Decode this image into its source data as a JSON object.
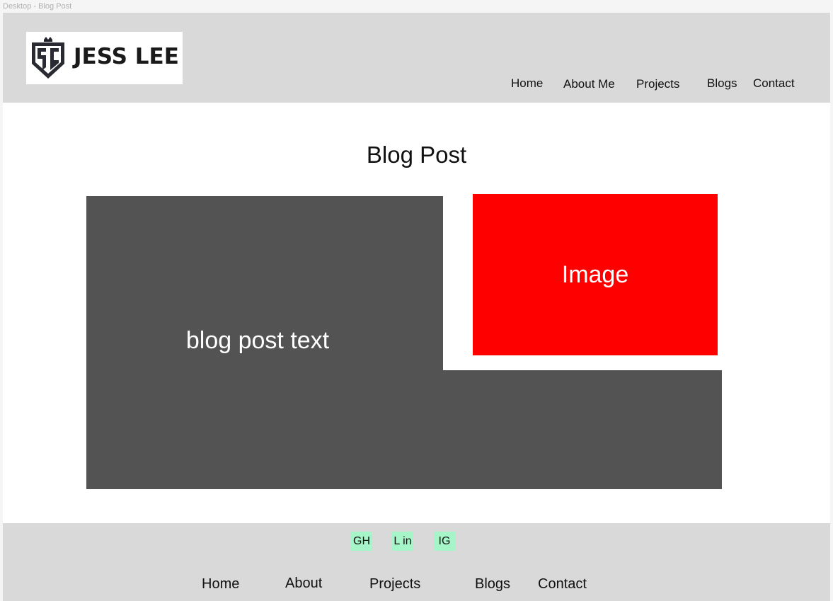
{
  "frame_label": "Desktop - Blog Post",
  "header": {
    "logo_text": "JESS LEE",
    "logo_icon": "shield-monogram-icon",
    "nav": [
      "Home",
      "About Me",
      "Projects",
      "Blogs",
      "Contact"
    ]
  },
  "main": {
    "title": "Blog Post",
    "text_placeholder": "blog post text",
    "image_placeholder": "Image"
  },
  "footer": {
    "social": [
      "GH",
      "L in",
      "IG"
    ],
    "nav": [
      "Home",
      "About",
      "Projects",
      "Blogs",
      "Contact"
    ]
  },
  "colors": {
    "bar_gray": "#d9d9d9",
    "text_block": "#535353",
    "image_red": "#ff0000",
    "social_green": "#a6f5c8"
  }
}
